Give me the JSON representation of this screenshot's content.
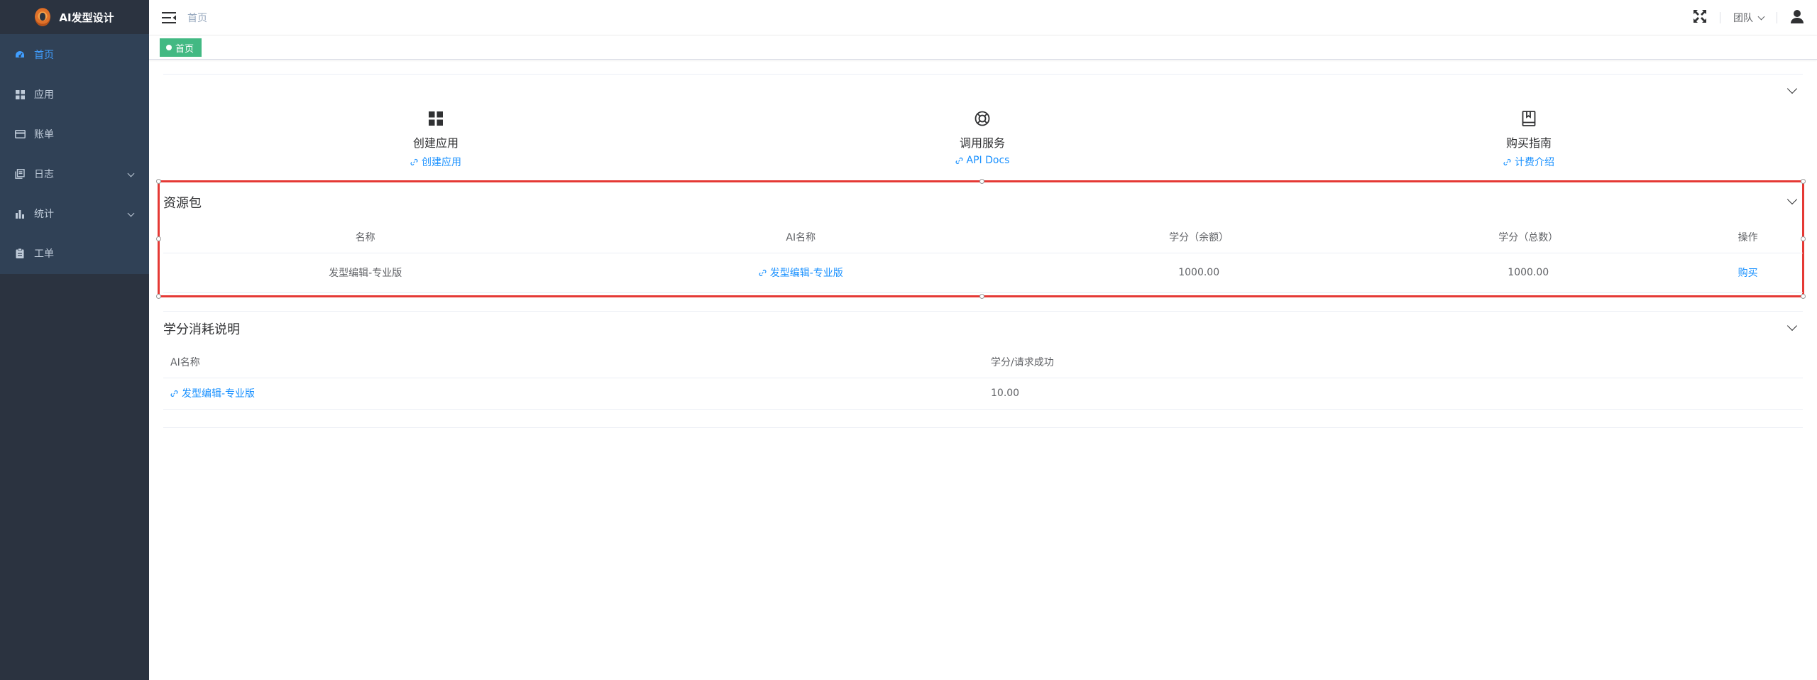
{
  "app": {
    "title": "AI发型设计"
  },
  "sidebar": {
    "items": [
      {
        "label": "首页",
        "icon": "dashboard-icon",
        "active": true
      },
      {
        "label": "应用",
        "icon": "apps-grid-icon"
      },
      {
        "label": "账单",
        "icon": "credit-card-icon"
      },
      {
        "label": "日志",
        "icon": "documents-icon",
        "has_children": true
      },
      {
        "label": "统计",
        "icon": "bar-chart-icon",
        "has_children": true
      },
      {
        "label": "工单",
        "icon": "clipboard-icon"
      }
    ]
  },
  "navbar": {
    "breadcrumb": "首页",
    "team_label": "团队"
  },
  "tags": [
    {
      "label": "首页"
    }
  ],
  "quick_links": [
    {
      "title": "创建应用",
      "link": "创建应用",
      "icon": "apps-grid-icon"
    },
    {
      "title": "调用服务",
      "link": "API Docs",
      "icon": "lifebuoy-icon"
    },
    {
      "title": "购买指南",
      "link": "计费介绍",
      "icon": "book-icon"
    }
  ],
  "resource_pack": {
    "title": "资源包",
    "columns": [
      "名称",
      "AI名称",
      "学分（余额）",
      "学分（总数）",
      "操作"
    ],
    "rows": [
      {
        "name": "发型编辑-专业版",
        "ai_name": "发型编辑-专业版",
        "balance": "1000.00",
        "total": "1000.00",
        "action": "购买"
      }
    ]
  },
  "credit_usage": {
    "title": "学分消耗说明",
    "columns": [
      "AI名称",
      "学分/请求成功"
    ],
    "rows": [
      {
        "ai_name": "发型编辑-专业版",
        "credits": "10.00"
      }
    ]
  },
  "colors": {
    "sidebar_bg": "#2b3340",
    "menu_bg": "#304156",
    "active": "#409eff",
    "link": "#1890ff",
    "tag": "#42b983",
    "highlight": "#e53935"
  }
}
